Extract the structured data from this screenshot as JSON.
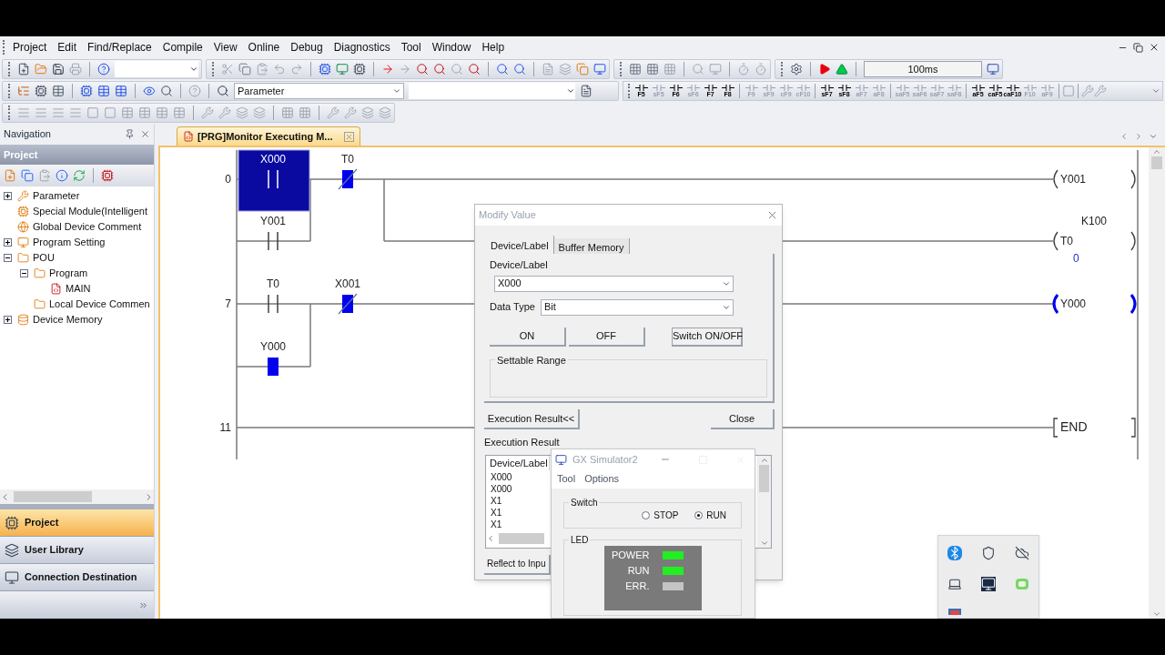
{
  "menu": [
    "Project",
    "Edit",
    "Find/Replace",
    "Compile",
    "View",
    "Online",
    "Debug",
    "Diagnostics",
    "Tool",
    "Window",
    "Help"
  ],
  "toolbar": {
    "device_combo": "Parameter",
    "monitor_interval": "100ms"
  },
  "fkeys": [
    {
      "label": "F5",
      "disabled": false
    },
    {
      "label": "sF5",
      "disabled": true
    },
    {
      "label": "F6",
      "disabled": false
    },
    {
      "label": "sF6",
      "disabled": true
    },
    {
      "label": "F7",
      "disabled": false
    },
    {
      "label": "F8",
      "disabled": false
    },
    {
      "label": "F9",
      "disabled": true
    },
    {
      "label": "sF9",
      "disabled": true
    },
    {
      "label": "cF9",
      "disabled": true
    },
    {
      "label": "cF10",
      "disabled": true
    },
    {
      "label": "sF7",
      "disabled": false
    },
    {
      "label": "sF8",
      "disabled": false
    },
    {
      "label": "aF7",
      "disabled": true
    },
    {
      "label": "aF8",
      "disabled": true
    },
    {
      "label": "saF5",
      "disabled": true
    },
    {
      "label": "saF6",
      "disabled": true
    },
    {
      "label": "saF7",
      "disabled": true
    },
    {
      "label": "saF8",
      "disabled": true
    },
    {
      "label": "aF5",
      "disabled": false
    },
    {
      "label": "caF5",
      "disabled": false
    },
    {
      "label": "caF10",
      "disabled": false
    },
    {
      "label": "F10",
      "disabled": true
    },
    {
      "label": "aF9",
      "disabled": true
    }
  ],
  "navigation": {
    "title": "Navigation",
    "section": "Project",
    "tree": [
      {
        "label": "Parameter",
        "expanded": false
      },
      {
        "label": "Special Module(Intelligent"
      },
      {
        "label": "Global Device Comment"
      },
      {
        "label": "Program Setting",
        "expanded": false
      },
      {
        "label": "POU",
        "expanded": true,
        "children": [
          {
            "label": "Program",
            "expanded": true,
            "children": [
              {
                "label": "MAIN"
              }
            ]
          },
          {
            "label": "Local Device Commen"
          }
        ]
      },
      {
        "label": "Device Memory",
        "expanded": false
      }
    ],
    "buttons": [
      {
        "label": "Project",
        "selected": true
      },
      {
        "label": "User Library",
        "selected": false
      },
      {
        "label": "Connection Destination",
        "selected": false
      }
    ]
  },
  "editor_tab": {
    "label": "[PRG]Monitor Executing M...",
    "selected": true
  },
  "ladder": {
    "steps": [
      "0",
      "7",
      "11"
    ],
    "contacts": [
      {
        "label": "X000",
        "kind": "no",
        "on": false,
        "selected": true
      },
      {
        "label": "T0",
        "kind": "nc",
        "on": true,
        "selected": false
      },
      {
        "label": "Y001",
        "kind": "no",
        "on": false,
        "selected": false
      },
      {
        "label": "T0",
        "kind": "no",
        "on": false,
        "selected": false
      },
      {
        "label": "X001",
        "kind": "nc",
        "on": true,
        "selected": false
      },
      {
        "label": "Y000",
        "kind": "no",
        "on": true,
        "selected": false
      }
    ],
    "coils": [
      {
        "label": "Y001",
        "kind": "coil",
        "on": false
      },
      {
        "label": "T0",
        "kind": "coil",
        "on": false,
        "setting": "K100",
        "current": "0"
      },
      {
        "label": "Y000",
        "kind": "coil",
        "on": true
      },
      {
        "label": "END",
        "kind": "end",
        "on": false
      }
    ]
  },
  "modify_value": {
    "title": "Modify Value",
    "tabs": [
      {
        "label": "Device/Label",
        "selected": true
      },
      {
        "label": "Buffer Memory",
        "selected": false
      }
    ],
    "device_label": {
      "label": "Device/Label",
      "value": "X000"
    },
    "data_type": {
      "label": "Data Type",
      "value": "Bit"
    },
    "buttons": [
      "ON",
      "OFF",
      "Switch ON/OFF"
    ],
    "settable_range": "Settable Range",
    "execution_result_button": "Execution Result<<",
    "close_button": "Close",
    "execution_result": {
      "label": "Execution Result",
      "column": "Device/Label",
      "rows": [
        "X000",
        "X000",
        "X1",
        "X1",
        "X1"
      ]
    },
    "reflect_button": "Reflect to Inpu"
  },
  "simulator": {
    "title": "GX Simulator2",
    "menu": [
      "Tool",
      "Options"
    ],
    "switch": {
      "label": "Switch",
      "options": [
        {
          "label": "STOP",
          "selected": false
        },
        {
          "label": "RUN",
          "selected": true
        }
      ]
    },
    "led": {
      "label": "LED",
      "lamps": [
        {
          "label": "POWER",
          "on": true
        },
        {
          "label": "RUN",
          "on": true
        },
        {
          "label": "ERR.",
          "on": false
        }
      ]
    }
  }
}
